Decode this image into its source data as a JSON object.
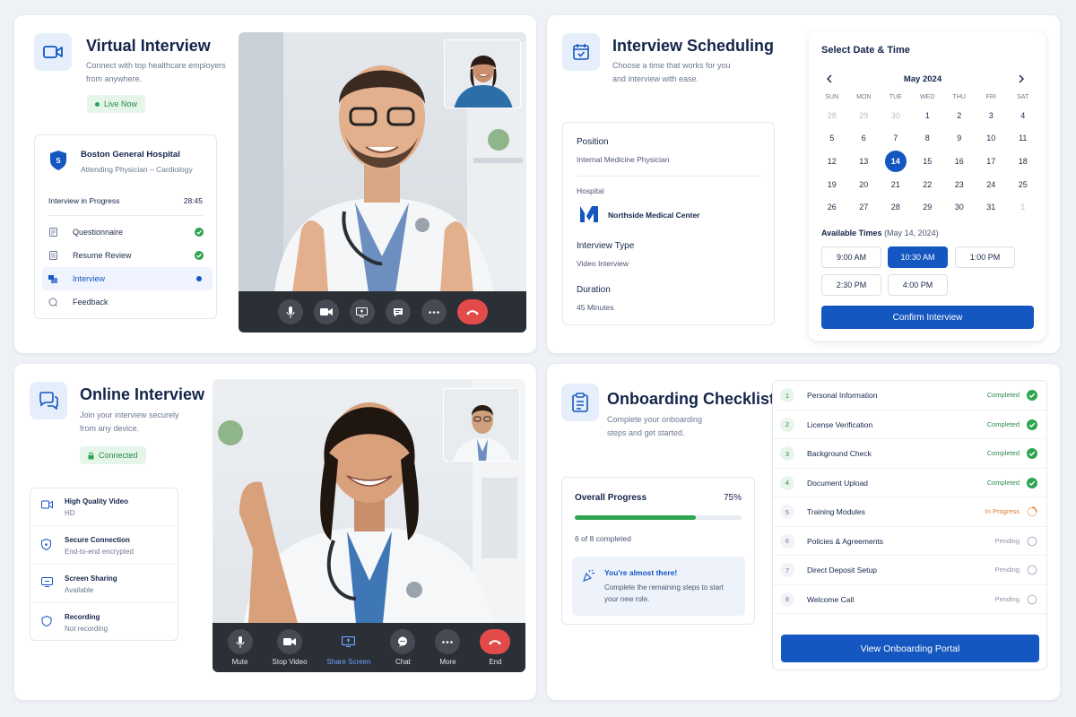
{
  "virtual": {
    "title": "Virtual Interview",
    "subtitle_line1": "Connect with top healthcare employers",
    "subtitle_line2": "from anywhere.",
    "badge": "Live Now",
    "hospital": "Boston General Hospital",
    "role": "Attending Physician – Cardiology",
    "progress_label": "Interview in Progress",
    "timer": "28:45",
    "steps": [
      {
        "label": "Questionnaire",
        "status": "done"
      },
      {
        "label": "Resume Review",
        "status": "done"
      },
      {
        "label": "Interview",
        "status": "active"
      },
      {
        "label": "Feedback",
        "status": "pending"
      }
    ]
  },
  "scheduling": {
    "title": "Interview Scheduling",
    "subtitle_line1": "Choose a time that works for you",
    "subtitle_line2": "and interview with ease.",
    "position_label": "Position",
    "position_value": "Internal Medicine Physician",
    "hospital_label": "Hospital",
    "hospital_value": "Northside Medical Center",
    "type_label": "Interview Type",
    "type_value": "Video Interview",
    "duration_label": "Duration",
    "duration_value": "45 Minutes",
    "picker_title": "Select Date & Time",
    "month": "May 2024",
    "weekdays": [
      "SUN",
      "MON",
      "TUE",
      "WED",
      "THU",
      "FRI",
      "SAT"
    ],
    "days": [
      {
        "d": "28",
        "m": true
      },
      {
        "d": "29",
        "m": true
      },
      {
        "d": "30",
        "m": true
      },
      {
        "d": "1"
      },
      {
        "d": "2"
      },
      {
        "d": "3"
      },
      {
        "d": "4"
      },
      {
        "d": "5"
      },
      {
        "d": "6"
      },
      {
        "d": "7"
      },
      {
        "d": "8"
      },
      {
        "d": "9"
      },
      {
        "d": "10"
      },
      {
        "d": "11"
      },
      {
        "d": "12"
      },
      {
        "d": "13"
      },
      {
        "d": "14",
        "sel": true
      },
      {
        "d": "15"
      },
      {
        "d": "16"
      },
      {
        "d": "17"
      },
      {
        "d": "18"
      },
      {
        "d": "19"
      },
      {
        "d": "20"
      },
      {
        "d": "21"
      },
      {
        "d": "22"
      },
      {
        "d": "23"
      },
      {
        "d": "24"
      },
      {
        "d": "25"
      },
      {
        "d": "26"
      },
      {
        "d": "27"
      },
      {
        "d": "28"
      },
      {
        "d": "29"
      },
      {
        "d": "30"
      },
      {
        "d": "31"
      },
      {
        "d": "1",
        "m": true
      }
    ],
    "times_label": "Available Times",
    "times_date": "(May 14, 2024)",
    "times": [
      "9:00 AM",
      "10:30 AM",
      "1:00 PM",
      "2:30 PM",
      "4:00 PM"
    ],
    "selected_time": "10:30 AM",
    "confirm": "Confirm Interview"
  },
  "online": {
    "title": "Online Interview",
    "subtitle_line1": "Join your interview securely",
    "subtitle_line2": "from any device.",
    "badge": "Connected",
    "features": [
      {
        "title": "High Quality Video",
        "sub": "HD",
        "icon": "video-icon"
      },
      {
        "title": "Secure Connection",
        "sub": "End-to-end encrypted",
        "icon": "shield-icon"
      },
      {
        "title": "Screen Sharing",
        "sub": "Available",
        "icon": "screen-share-icon"
      },
      {
        "title": "Recording",
        "sub": "Not recording",
        "icon": "record-icon"
      }
    ],
    "controls": [
      "Mute",
      "Stop Video",
      "Share Screen",
      "Chat",
      "More",
      "End"
    ]
  },
  "onboarding": {
    "title": "Onboarding Checklist",
    "subtitle_line1": "Complete your onboarding",
    "subtitle_line2": "steps and get started.",
    "progress_title": "Overall Progress",
    "progress_pct": "75%",
    "progress_value": 0.75,
    "completed_text": "6 of 8 completed",
    "tip_title": "You're almost there!",
    "tip_line1": "Complete the remaining steps to start",
    "tip_line2": "your new role.",
    "items": [
      {
        "n": "1",
        "label": "Personal Information",
        "status": "Completed"
      },
      {
        "n": "2",
        "label": "License Verification",
        "status": "Completed"
      },
      {
        "n": "3",
        "label": "Background Check",
        "status": "Completed"
      },
      {
        "n": "4",
        "label": "Document Upload",
        "status": "Completed"
      },
      {
        "n": "5",
        "label": "Training Modules",
        "status": "In Progress"
      },
      {
        "n": "6",
        "label": "Policies & Agreements",
        "status": "Pending"
      },
      {
        "n": "7",
        "label": "Direct Deposit Setup",
        "status": "Pending"
      },
      {
        "n": "8",
        "label": "Welcome Call",
        "status": "Pending"
      }
    ],
    "portal_button": "View Onboarding Portal"
  },
  "colors": {
    "primary": "#1457c0",
    "success": "#2ea44f",
    "warning": "#e07b2d",
    "end_call": "#e34a4a"
  }
}
